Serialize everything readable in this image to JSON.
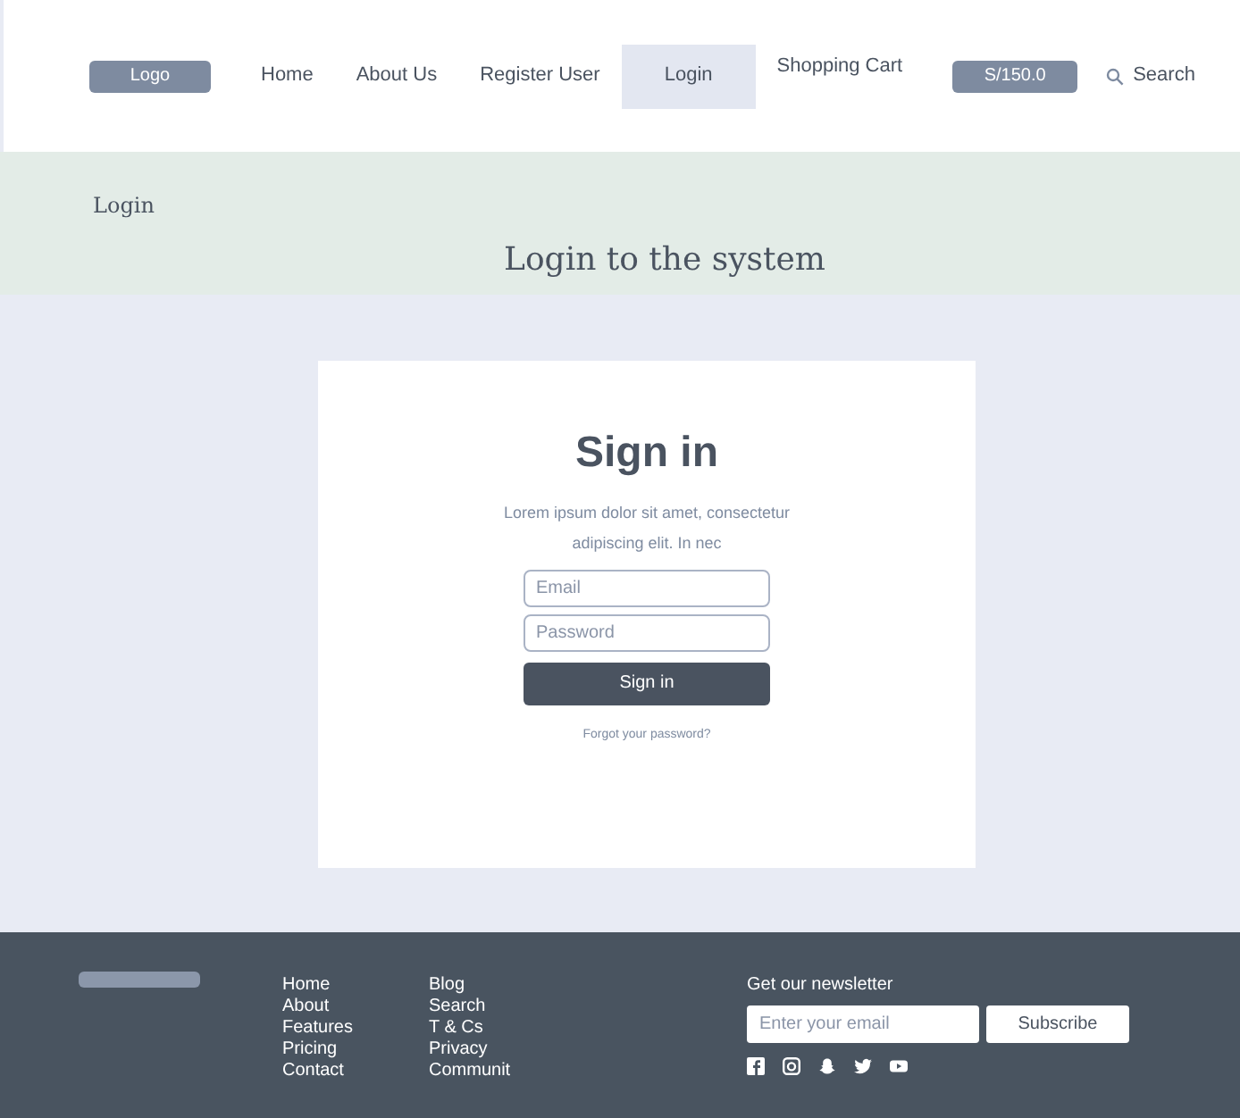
{
  "navbar": {
    "logo": "Logo",
    "items": [
      {
        "label": "Home",
        "selected": false
      },
      {
        "label": "About Us",
        "selected": false
      },
      {
        "label": "Register User",
        "selected": false
      },
      {
        "label": "Login",
        "selected": true
      },
      {
        "label": "Shopping Cart",
        "selected": false
      }
    ],
    "cart_total": "S/150.0",
    "search": "Search"
  },
  "header": {
    "breadcrumb": "Login",
    "title": "Login to the system"
  },
  "signin": {
    "title": "Sign in",
    "text": "Lorem ipsum dolor sit amet, consectetur adipiscing elit. In nec",
    "email_placeholder": "Email",
    "password_placeholder": "Password",
    "button": "Sign in",
    "forgot": "Forgot your password?"
  },
  "footer": {
    "columns": [
      [
        "Home",
        "About",
        "Features",
        "Pricing",
        "Contact"
      ],
      [
        "Blog",
        "Search",
        "T & Cs",
        "Privacy",
        "Communit"
      ]
    ],
    "newsletter": {
      "title": "Get our newsletter",
      "placeholder": "Enter your email",
      "button": "Subscribe"
    },
    "social": [
      {
        "kind": "facebook"
      },
      {
        "kind": "instagram"
      },
      {
        "kind": "snapchat"
      },
      {
        "kind": "twitter"
      },
      {
        "kind": "youtube"
      }
    ]
  }
}
